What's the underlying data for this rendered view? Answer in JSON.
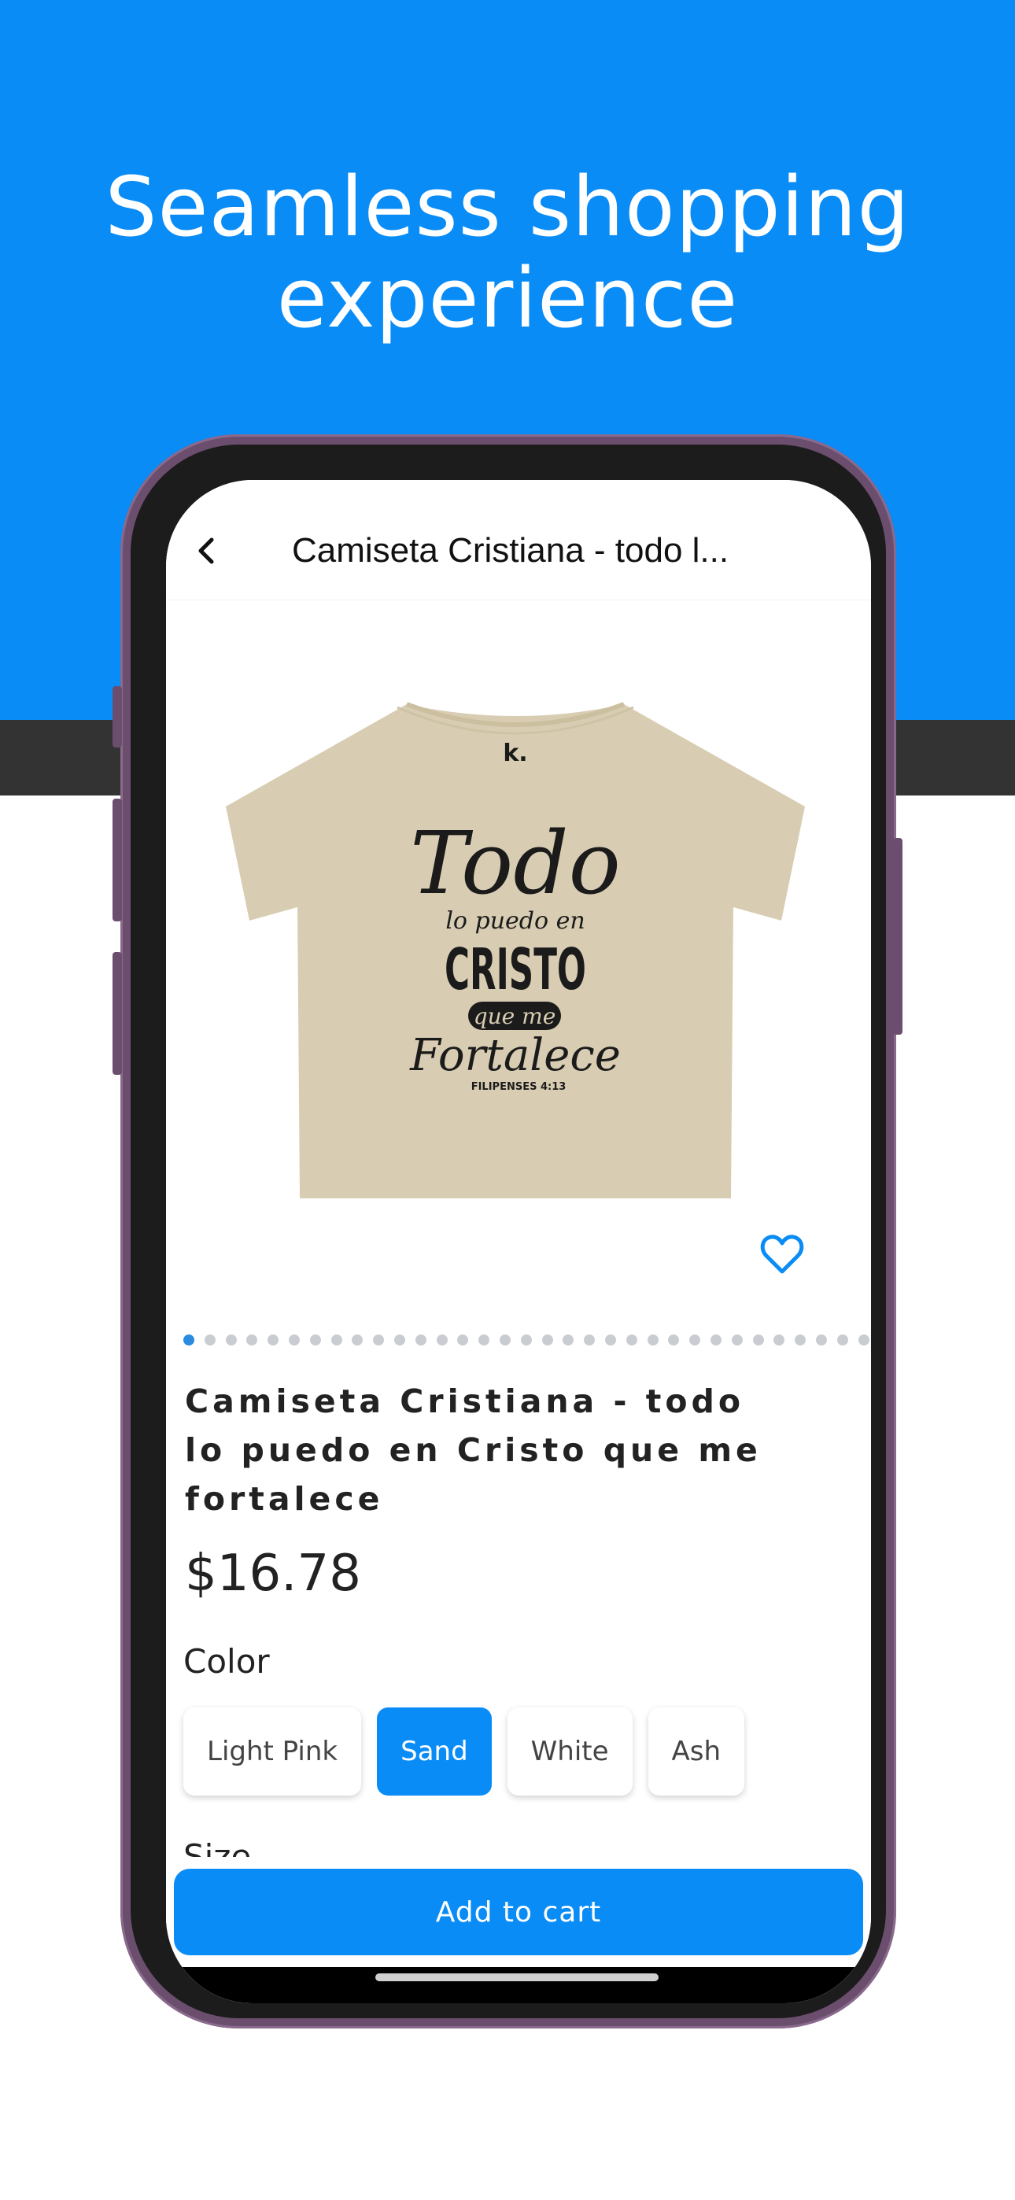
{
  "headline": {
    "line1": "Seamless shopping",
    "line2": "experience"
  },
  "nav": {
    "back_icon": "chevron-left-icon",
    "title": "Camiseta Cristiana - todo l..."
  },
  "product": {
    "image": {
      "brand_mark": "k.",
      "print_lines": [
        "Todo",
        "lo puedo en",
        "CRISTO",
        "que me",
        "Fortalece",
        "FILIPENSES 4:13"
      ]
    },
    "favorite_icon": "heart-outline-icon",
    "carousel": {
      "total": 33,
      "active_index": 0
    },
    "name_lines": [
      "Camiseta Cristiana - todo",
      "lo puedo en Cristo que me",
      "fortalece"
    ],
    "price": "$16.78"
  },
  "color": {
    "label": "Color",
    "options": [
      {
        "label": "Light Pink",
        "selected": false
      },
      {
        "label": "Sand",
        "selected": true
      },
      {
        "label": "White",
        "selected": false
      },
      {
        "label": "Ash",
        "selected": false
      }
    ]
  },
  "size": {
    "label": "Size"
  },
  "cart": {
    "button_label": "Add to cart"
  },
  "colors": {
    "accent": "#0a8cf7",
    "dark_band": "#333333",
    "phone_frame": "#6b4e6e",
    "shirt": "#d8cdb2",
    "dot_active": "#2a8be0",
    "dot_inactive": "#c9cdd2"
  }
}
